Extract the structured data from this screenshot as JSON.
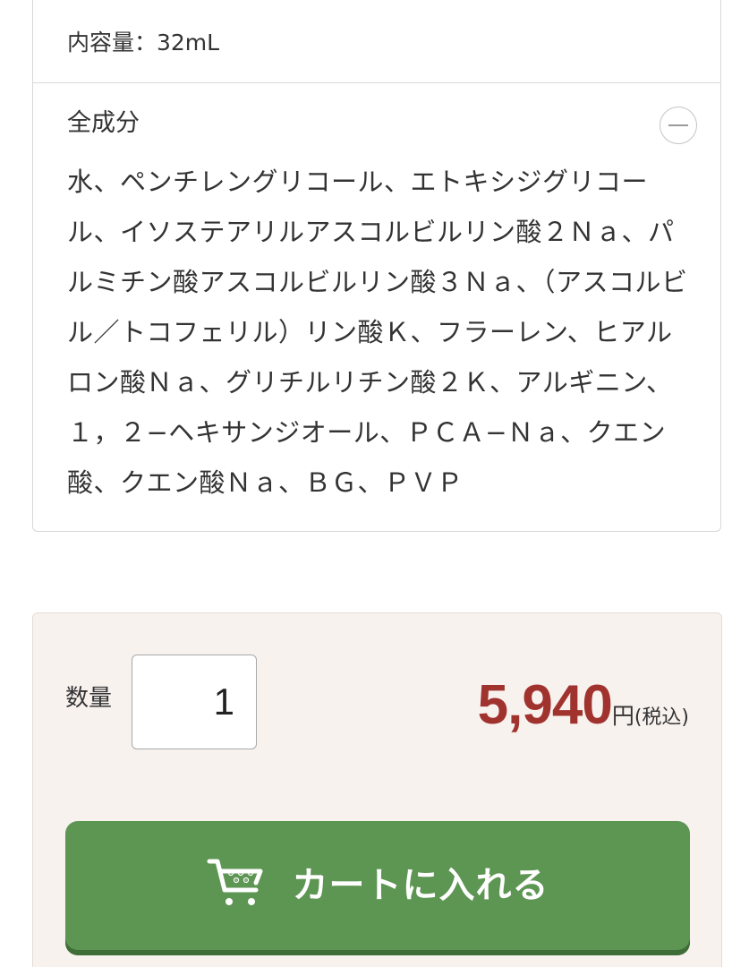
{
  "spec": {
    "volume": "内容量：32mL",
    "ingredients_heading": "全成分",
    "collapse_icon": "minus-circle-icon",
    "ingredients_text": "水、ペンチレングリコール、エトキシジグリコール、イソステアリルアスコルビルリン酸２Ｎａ、パルミチン酸アスコルビルリン酸３Ｎａ、（アスコルビル／トコフェリル）リン酸Ｋ、フラーレン、ヒアルロン酸Ｎａ、グリチルリチン酸２Ｋ、アルギニン、１，２−ヘキサンジオール、ＰＣＡ−Ｎａ、クエン酸、クエン酸Ｎａ、ＢＧ、ＰＶＰ"
  },
  "purchase": {
    "quantity_label": "数量",
    "quantity_value": "1",
    "price_value": "5,940",
    "price_unit": "円",
    "price_tax": "(税込)",
    "price_color": "#a1332f",
    "cart_button_label": "カートに入れる",
    "cart_icon": "shopping-cart-icon",
    "cart_button_color": "#5d9553"
  }
}
